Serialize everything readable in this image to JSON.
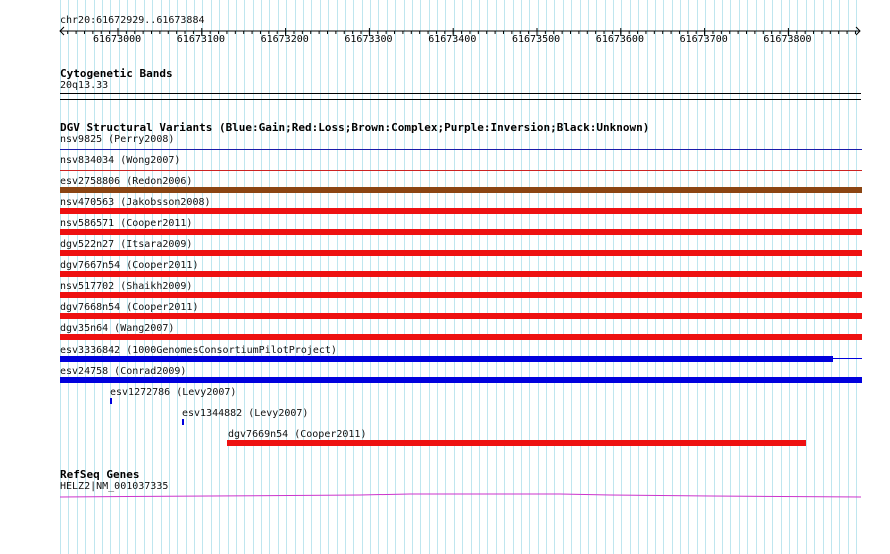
{
  "region": "chr20:61672929..61673884",
  "ruler": {
    "ticks": [
      "61673000",
      "61673100",
      "61673200",
      "61673300",
      "61673400",
      "61673500",
      "61673600",
      "61673700",
      "61673800"
    ]
  },
  "cytoband": {
    "title": "Cytogenetic Bands",
    "band": "20q13.33"
  },
  "dgv": {
    "title": "DGV Structural Variants (Blue:Gain;Red:Loss;Brown:Complex;Purple:Inversion;Black:Unknown)",
    "tracks": [
      {
        "label": "nsv9825 (Perry2008)",
        "color": "#1a1aaa",
        "kind": "line"
      },
      {
        "label": "nsv834034 (Wong2007)",
        "color": "#cc2222",
        "kind": "line"
      },
      {
        "label": "esv2758806 (Redon2006)",
        "color": "#8b4513",
        "kind": "bar"
      },
      {
        "label": "nsv470563 (Jakobsson2008)",
        "color": "#ee1111",
        "kind": "bar"
      },
      {
        "label": "nsv586571 (Cooper2011)",
        "color": "#ee1111",
        "kind": "bar"
      },
      {
        "label": "dgv522n27 (Itsara2009)",
        "color": "#ee1111",
        "kind": "bar"
      },
      {
        "label": "dgv7667n54 (Cooper2011)",
        "color": "#ee1111",
        "kind": "bar"
      },
      {
        "label": "nsv517702 (Shaikh2009)",
        "color": "#ee1111",
        "kind": "bar"
      },
      {
        "label": "dgv7668n54 (Cooper2011)",
        "color": "#ee1111",
        "kind": "bar"
      },
      {
        "label": "dgv35n64 (Wang2007)",
        "color": "#ee1111",
        "kind": "bar"
      },
      {
        "label": "esv3336842 (1000GenomesConsortiumPilotProject)",
        "color": "#0000dd",
        "kind": "bar-partial"
      },
      {
        "label": "esv24758 (Conrad2009)",
        "color": "#0000dd",
        "kind": "bar"
      }
    ],
    "small": [
      {
        "label": "esv1272786 (Levy2007)",
        "color": "#0000dd"
      },
      {
        "label": "esv1344882 (Levy2007)",
        "color": "#0000dd"
      },
      {
        "label": "dgv7669n54 (Cooper2011)",
        "color": "#ee1111"
      }
    ]
  },
  "refseq": {
    "title": "RefSeq Genes",
    "gene": "HELZ2|NM_001037335",
    "color": "#cc33cc"
  }
}
